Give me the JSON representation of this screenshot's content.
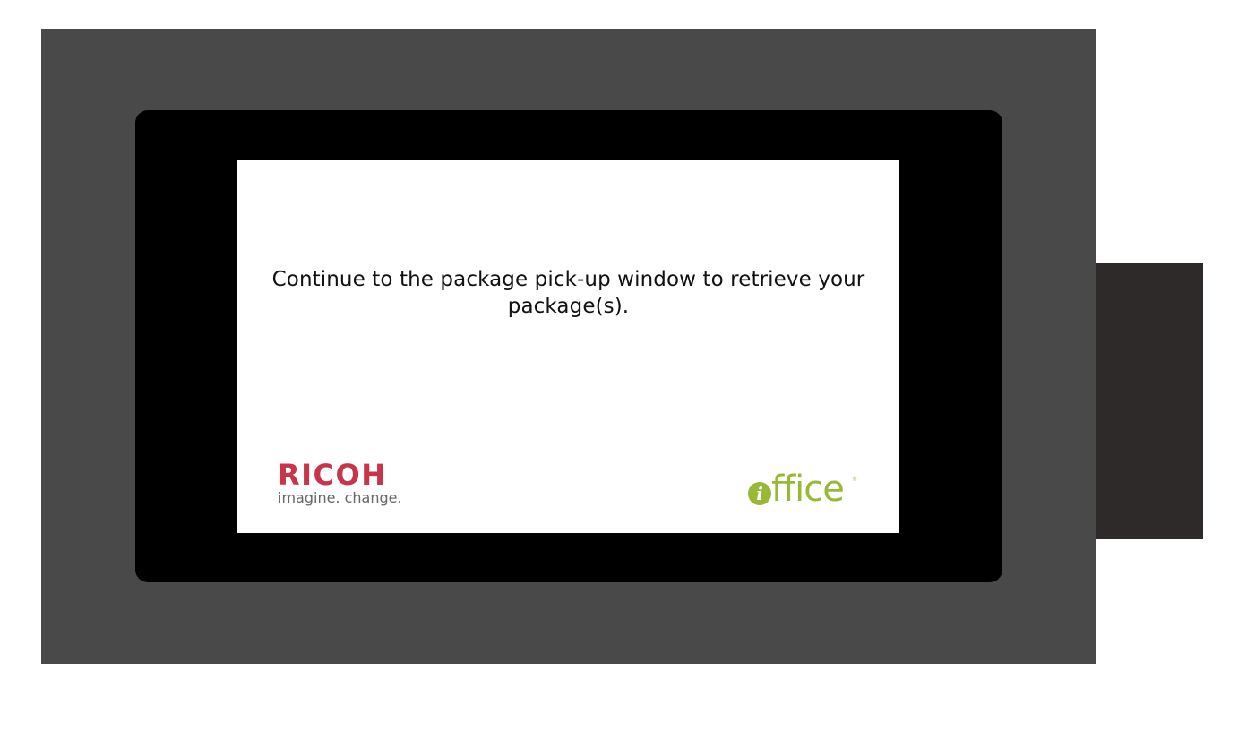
{
  "screen": {
    "message": "Continue to the package pick-up window to retrieve your package(s)."
  },
  "logos": {
    "ricoh": {
      "name": "RICOH",
      "tagline": "imagine. change.",
      "color": "#c8344a"
    },
    "iffice": {
      "badge_letter": "i",
      "name": "ffice",
      "registered": "®",
      "color": "#98b935"
    }
  },
  "colors": {
    "kiosk_body": "#494949",
    "side_panel": "#2d2a29",
    "bezel": "#000000",
    "screen": "#ffffff"
  }
}
